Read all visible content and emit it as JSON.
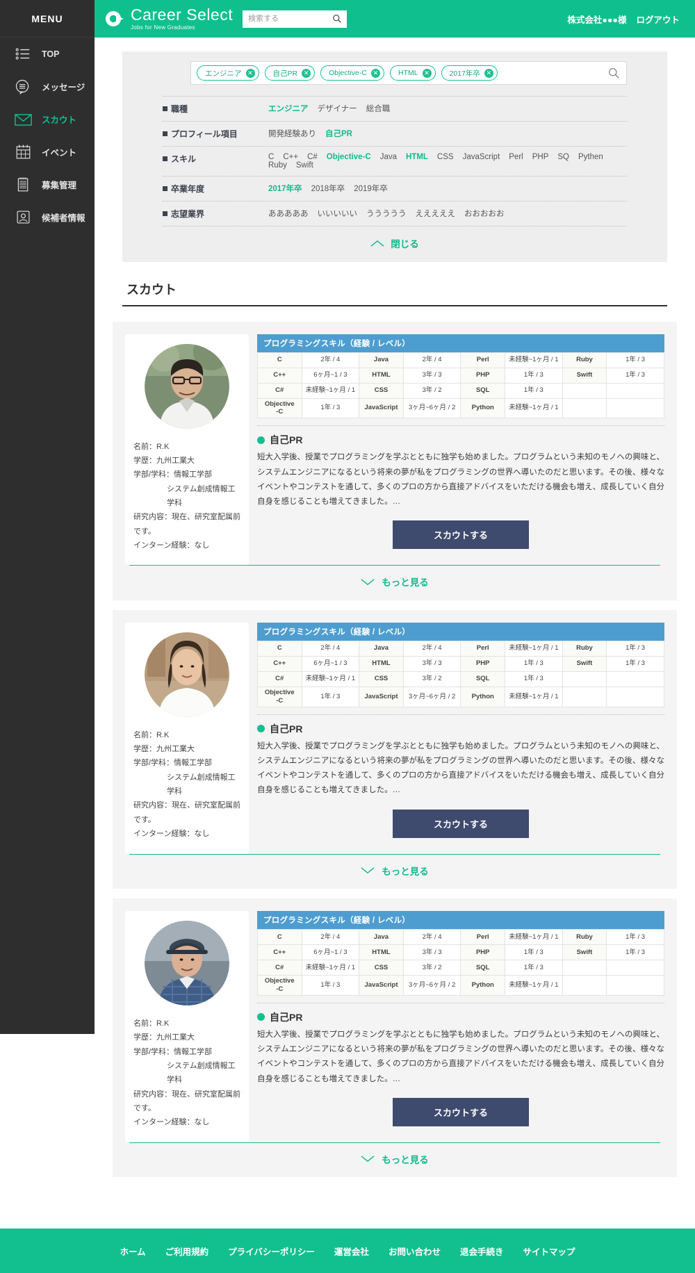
{
  "sidebar": {
    "menu_label": "MENU",
    "items": [
      {
        "label": "TOP",
        "icon": "list-icon",
        "active": false
      },
      {
        "label": "メッセージ",
        "icon": "message-icon",
        "active": false
      },
      {
        "label": "スカウト",
        "icon": "envelope-icon",
        "active": true
      },
      {
        "label": "イベント",
        "icon": "calendar-icon",
        "active": false
      },
      {
        "label": "募集管理",
        "icon": "notepad-icon",
        "active": false
      },
      {
        "label": "候補者情報",
        "icon": "person-card-icon",
        "active": false
      }
    ]
  },
  "header": {
    "brand_title": "Career Select",
    "brand_sub": "Jobs for New Graduates",
    "search_placeholder": "検索する",
    "search_value": "",
    "company": "株式会社●●●様",
    "logout": "ログアウト",
    "accent": "#0fc08e"
  },
  "filter": {
    "tags": [
      {
        "label": "エンジニア"
      },
      {
        "label": "自己PR"
      },
      {
        "label": "Objective-C"
      },
      {
        "label": "HTML"
      },
      {
        "label": "2017年卒"
      }
    ],
    "rows": [
      {
        "label": "職種",
        "values": [
          {
            "text": "エンジニア",
            "selected": true
          },
          {
            "text": "デザイナー",
            "selected": false
          },
          {
            "text": "総合職",
            "selected": false
          }
        ]
      },
      {
        "label": "プロフィール項目",
        "values": [
          {
            "text": "開発経験あり",
            "selected": false
          },
          {
            "text": "自己PR",
            "selected": true
          }
        ]
      },
      {
        "label": "スキル",
        "values": [
          {
            "text": "C",
            "selected": false
          },
          {
            "text": "C++",
            "selected": false
          },
          {
            "text": "C#",
            "selected": false
          },
          {
            "text": "Objective-C",
            "selected": true
          },
          {
            "text": "Java",
            "selected": false
          },
          {
            "text": "HTML",
            "selected": true
          },
          {
            "text": "CSS",
            "selected": false
          },
          {
            "text": "JavaScript",
            "selected": false
          },
          {
            "text": "Perl",
            "selected": false
          },
          {
            "text": "PHP",
            "selected": false
          },
          {
            "text": "SQ",
            "selected": false
          },
          {
            "text": "Pythen",
            "selected": false
          },
          {
            "text": "Ruby",
            "selected": false
          },
          {
            "text": "Swift",
            "selected": false
          }
        ]
      },
      {
        "label": "卒業年度",
        "values": [
          {
            "text": "2017年卒",
            "selected": true
          },
          {
            "text": "2018年卒",
            "selected": false
          },
          {
            "text": "2019年卒",
            "selected": false
          }
        ]
      },
      {
        "label": "志望業界",
        "values": [
          {
            "text": "あああああ",
            "selected": false
          },
          {
            "text": "いいいいい",
            "selected": false
          },
          {
            "text": "ううううう",
            "selected": false
          },
          {
            "text": "えええええ",
            "selected": false
          },
          {
            "text": "おおおおお",
            "selected": false
          }
        ]
      }
    ],
    "close_label": "閉じる"
  },
  "section": {
    "title": "スカウト"
  },
  "skill_table": {
    "header": "プログラミングスキル（経験 / レベル）",
    "rows": [
      [
        {
          "k": "C",
          "v": "2年 / 4"
        },
        {
          "k": "Java",
          "v": "2年 / 4"
        },
        {
          "k": "Perl",
          "v": "未経験~1ヶ月 / 1"
        },
        {
          "k": "Ruby",
          "v": "1年 / 3"
        }
      ],
      [
        {
          "k": "C++",
          "v": "6ヶ月~1 / 3"
        },
        {
          "k": "HTML",
          "v": "3年 / 3"
        },
        {
          "k": "PHP",
          "v": "1年 / 3"
        },
        {
          "k": "Swift",
          "v": "1年 / 3"
        }
      ],
      [
        {
          "k": "C#",
          "v": "未経験~1ヶ月 / 1"
        },
        {
          "k": "CSS",
          "v": "3年 / 2"
        },
        {
          "k": "SQL",
          "v": "1年 / 3"
        },
        {
          "k": "",
          "v": ""
        }
      ],
      [
        {
          "k": "Objective\n-C",
          "v": "1年 / 3"
        },
        {
          "k": "JavaScript",
          "v": "3ヶ月~6ヶ月 / 2"
        },
        {
          "k": "Python",
          "v": "未経験~1ヶ月 / 1"
        },
        {
          "k": "",
          "v": ""
        }
      ]
    ]
  },
  "candidates": [
    {
      "avatar": "man-glasses-photo",
      "name_label": "名前：R.K",
      "education_label": "学歴：九州工業大",
      "faculty_label": "学部/学科：情報工学部",
      "department_label": "システム創成情報工学科",
      "research_label": "研究内容：現在、研究室配属前です。",
      "internship_label": "インターン経験：なし",
      "pr_heading": "自己PR",
      "pr_text": "短大入学後、授業でプログラミングを学ぶとともに独学も始めました。プログラムという未知のモノへの興味と、システムエンジニアになるという将来の夢が私をプログラミングの世界へ導いたのだと思います。その後、様々なイベントやコンテストを通して、多くのプロの方から直接アドバイスをいただける機会も増え、成長していく自分自身を感じることも増えてきました。…",
      "scout_button": "スカウトする",
      "more_button": "もっと見る"
    },
    {
      "avatar": "woman-photo",
      "name_label": "名前：R.K",
      "education_label": "学歴：九州工業大",
      "faculty_label": "学部/学科：情報工学部",
      "department_label": "システム創成情報工学科",
      "research_label": "研究内容：現在、研究室配属前です。",
      "internship_label": "インターン経験：なし",
      "pr_heading": "自己PR",
      "pr_text": "短大入学後、授業でプログラミングを学ぶとともに独学も始めました。プログラムという未知のモノへの興味と、システムエンジニアになるという将来の夢が私をプログラミングの世界へ導いたのだと思います。その後、様々なイベントやコンテストを通して、多くのプロの方から直接アドバイスをいただける機会も増え、成長していく自分自身を感じることも増えてきました。…",
      "scout_button": "スカウトする",
      "more_button": "もっと見る"
    },
    {
      "avatar": "man-cap-photo",
      "name_label": "名前：R.K",
      "education_label": "学歴：九州工業大",
      "faculty_label": "学部/学科：情報工学部",
      "department_label": "システム創成情報工学科",
      "research_label": "研究内容：現在、研究室配属前です。",
      "internship_label": "インターン経験：なし",
      "pr_heading": "自己PR",
      "pr_text": "短大入学後、授業でプログラミングを学ぶとともに独学も始めました。プログラムという未知のモノへの興味と、システムエンジニアになるという将来の夢が私をプログラミングの世界へ導いたのだと思います。その後、様々なイベントやコンテストを通して、多くのプロの方から直接アドバイスをいただける機会も増え、成長していく自分自身を感じることも増えてきました。…",
      "scout_button": "スカウトする",
      "more_button": "もっと見る"
    }
  ],
  "footer": {
    "links": [
      "ホーム",
      "ご利用規約",
      "プライバシーポリシー",
      "運営会社",
      "お問い合わせ",
      "退会手続き",
      "サイトマップ"
    ]
  }
}
